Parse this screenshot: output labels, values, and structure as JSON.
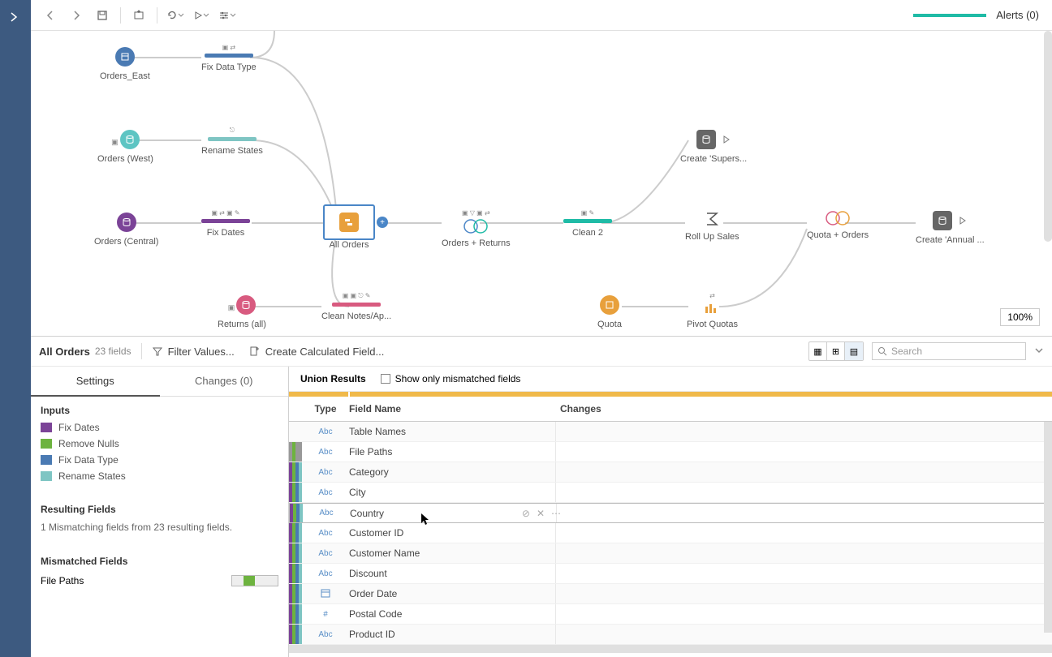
{
  "alerts": "Alerts (0)",
  "zoom": "100%",
  "nodes": {
    "orders_east": "Orders_East",
    "fix_data_type": "Fix Data Type",
    "orders_west": "Orders (West)",
    "rename_states": "Rename States",
    "orders_central": "Orders (Central)",
    "fix_dates": "Fix Dates",
    "all_orders": "All Orders",
    "orders_returns": "Orders + Returns",
    "clean2": "Clean 2",
    "rollup": "Roll Up Sales",
    "quota_orders": "Quota + Orders",
    "create_annual": "Create 'Annual ...",
    "returns_all": "Returns (all)",
    "clean_notes": "Clean Notes/Ap...",
    "quota": "Quota",
    "pivot_quotas": "Pivot Quotas",
    "create_super": "Create 'Supers..."
  },
  "profile": {
    "title": "All Orders",
    "fields": "23 fields",
    "filter": "Filter Values...",
    "calc": "Create Calculated Field...",
    "search": "Search"
  },
  "tabs": {
    "settings": "Settings",
    "changes": "Changes (0)"
  },
  "inputs_h": "Inputs",
  "inputs": [
    "Fix Dates",
    "Remove Nulls",
    "Fix Data Type",
    "Rename States"
  ],
  "resulting_h": "Resulting Fields",
  "resulting_text": "1 Mismatching fields from 23 resulting fields.",
  "mismatch_h": "Mismatched Fields",
  "mismatch_item": "File Paths",
  "union_title": "Union Results",
  "show_mismatch": "Show only mismatched fields",
  "cols": {
    "type": "Type",
    "field": "Field Name",
    "changes": "Changes"
  },
  "rows": [
    {
      "type": "Abc",
      "name": "Table Names",
      "stripes": []
    },
    {
      "type": "Abc",
      "name": "File Paths",
      "stripes": [
        "#999",
        "#6db33f",
        "#999",
        "#999"
      ]
    },
    {
      "type": "Abc",
      "name": "Category",
      "stripes": [
        "#7b4397",
        "#6db33f",
        "#4a7ab3",
        "#7ec5c3"
      ]
    },
    {
      "type": "Abc",
      "name": "City",
      "stripes": [
        "#7b4397",
        "#6db33f",
        "#4a7ab3",
        "#7ec5c3"
      ]
    },
    {
      "type": "Abc",
      "name": "Country",
      "stripes": [
        "#7b4397",
        "#6db33f",
        "#4a7ab3",
        "#7ec5c3"
      ],
      "hover": true
    },
    {
      "type": "Abc",
      "name": "Customer ID",
      "stripes": [
        "#7b4397",
        "#6db33f",
        "#4a7ab3",
        "#7ec5c3"
      ]
    },
    {
      "type": "Abc",
      "name": "Customer Name",
      "stripes": [
        "#7b4397",
        "#6db33f",
        "#4a7ab3",
        "#7ec5c3"
      ]
    },
    {
      "type": "Abc",
      "name": "Discount",
      "stripes": [
        "#7b4397",
        "#6db33f",
        "#4a7ab3",
        "#7ec5c3"
      ]
    },
    {
      "type": "date",
      "name": "Order Date",
      "stripes": [
        "#7b4397",
        "#6db33f",
        "#4a7ab3",
        "#7ec5c3"
      ]
    },
    {
      "type": "#",
      "name": "Postal Code",
      "stripes": [
        "#7b4397",
        "#6db33f",
        "#4a7ab3",
        "#7ec5c3"
      ]
    },
    {
      "type": "Abc",
      "name": "Product ID",
      "stripes": [
        "#7b4397",
        "#6db33f",
        "#4a7ab3",
        "#7ec5c3"
      ]
    }
  ]
}
